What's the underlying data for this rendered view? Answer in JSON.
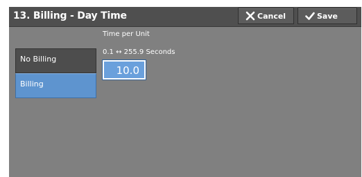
{
  "header": {
    "title": "13. Billing - Day Time",
    "cancel_label": "Cancel",
    "save_label": "Save",
    "cancel_icon": "close-icon",
    "save_icon": "check-icon"
  },
  "options": [
    {
      "label": "No Billing",
      "selected": false
    },
    {
      "label": "Billing",
      "selected": true
    }
  ],
  "time_per_unit": {
    "label": "Time per Unit",
    "range": "0.1 ↔ 255.9 Seconds",
    "value": "10.0"
  },
  "colors": {
    "titlebar": "#4f4f4f",
    "background": "#808080",
    "selected": "#5e94cf",
    "unselected": "#4d4d4d",
    "input": "#6aa0dc"
  }
}
